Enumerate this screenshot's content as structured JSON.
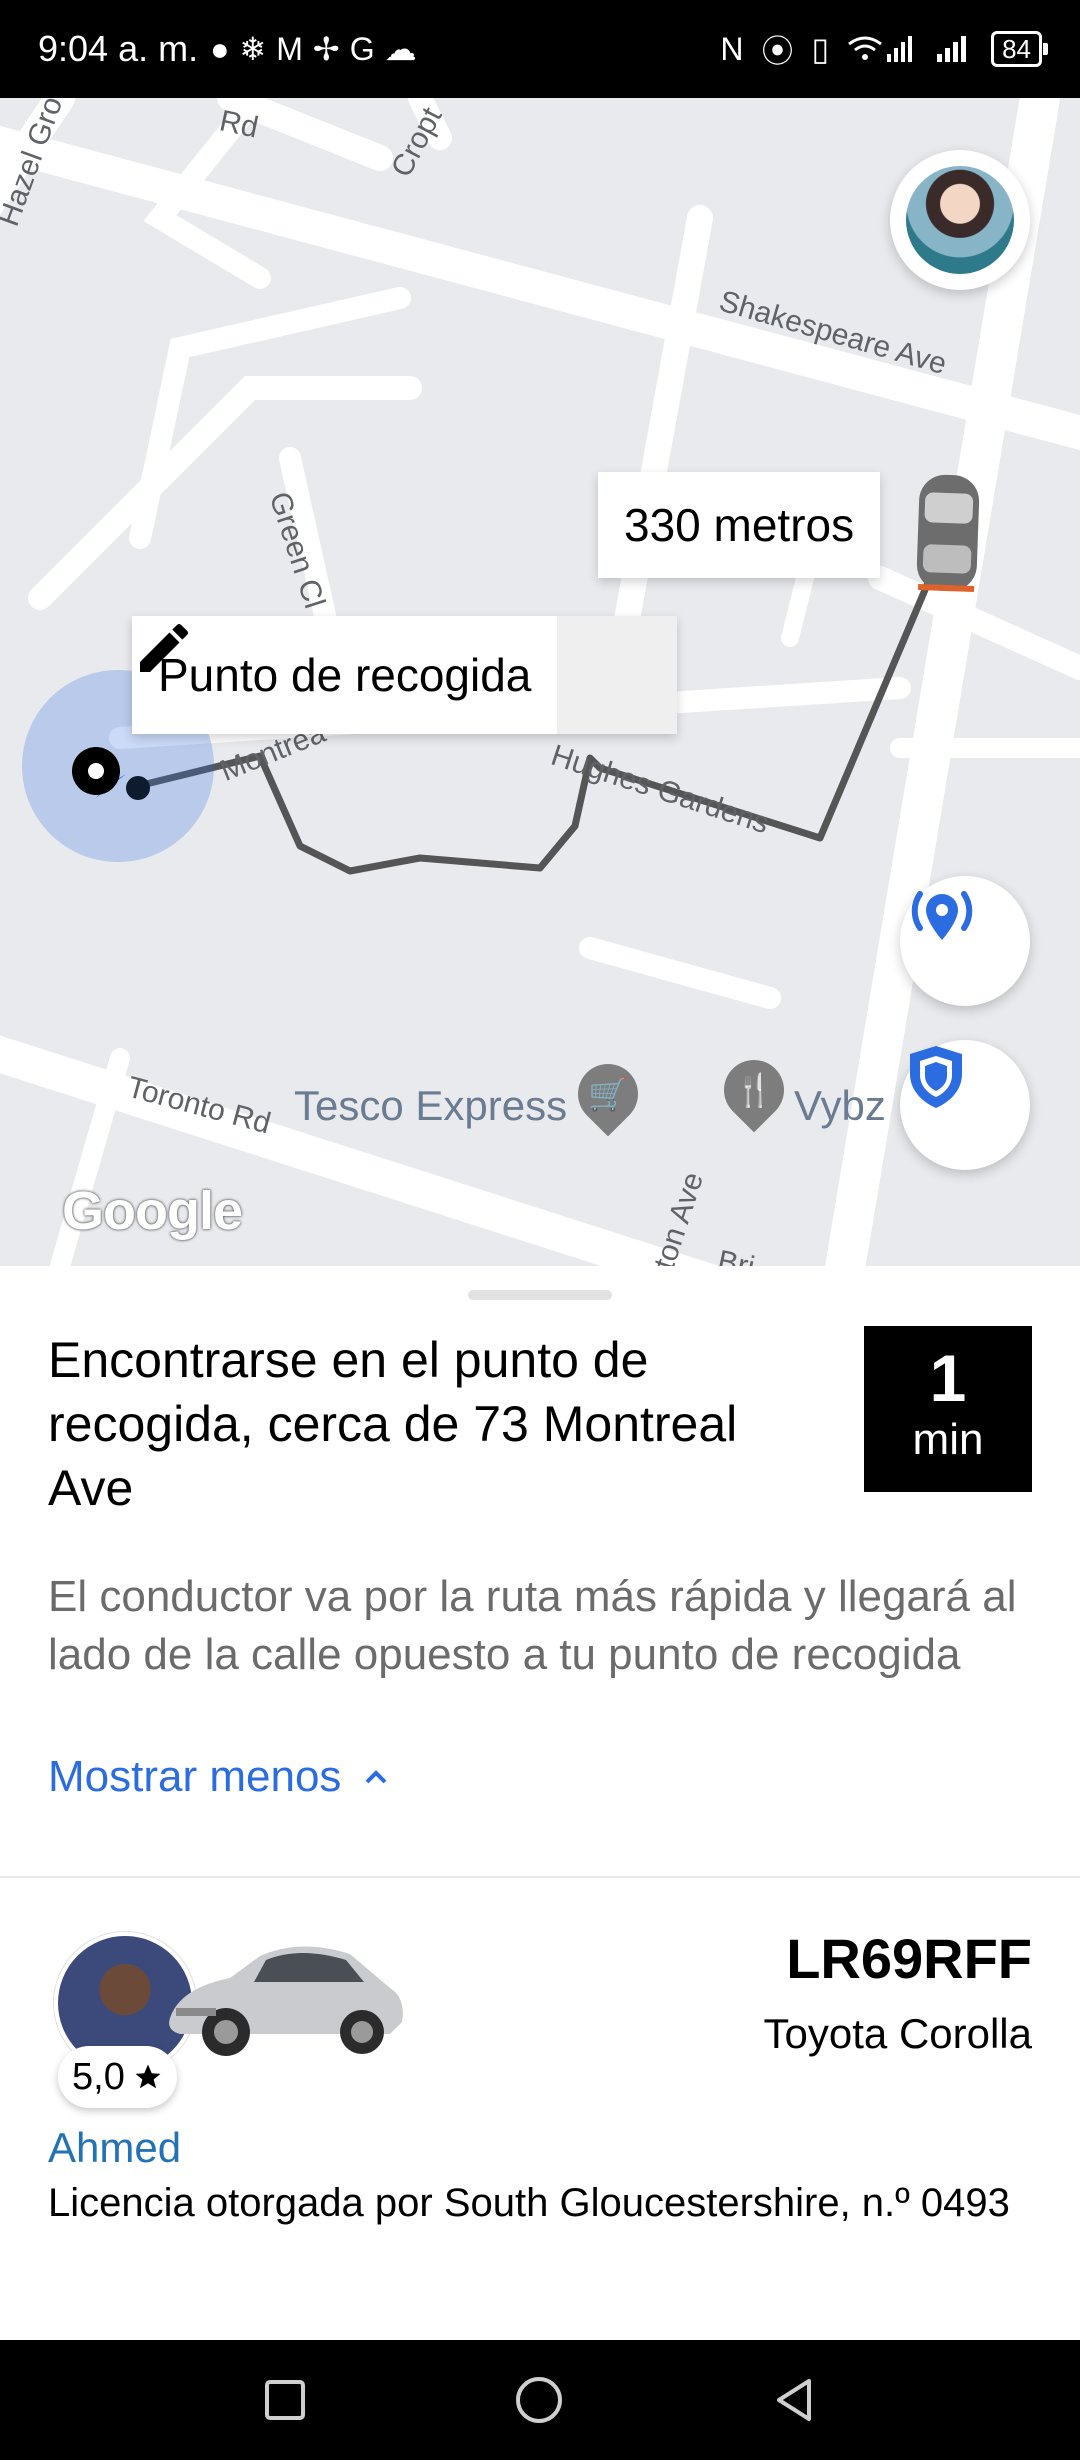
{
  "status_bar": {
    "time": "9:04 a. m.",
    "left_icons": [
      "●",
      "❄",
      "M",
      "✢",
      "G",
      "☁"
    ],
    "right_icons": [
      "N",
      "⦿",
      "▯"
    ],
    "battery": "84"
  },
  "map": {
    "streets": {
      "hazel_grove": "Hazel Grove",
      "top_rd": "Rd",
      "cropt": "Cropt",
      "shakespeare": "Shakespeare Ave",
      "green_cl": "Green Cl",
      "montreal": "Montrea",
      "hughes": "Hughes Gardens",
      "toronto": "Toronto Rd",
      "hamilton": "ilton Ave",
      "bri": "Bri"
    },
    "poi": {
      "tesco": "Tesco Express",
      "vybz": "Vybz"
    },
    "distance_label": "330 metros",
    "pickup_label": "Punto de recogida",
    "google_logo": "Google",
    "accent_color": "#2b6de0"
  },
  "sheet": {
    "heading": "Encontrarse en el punto de recogida, cerca de 73 Montreal Ave",
    "eta_number": "1",
    "eta_unit": "min",
    "description": "El conductor va por la ruta más rápida y llegará al lado de la calle opuesto a tu punto de recogida",
    "show_less": "Mostrar menos",
    "rating": "5,0",
    "plate": "LR69RFF",
    "car_model": "Toyota Corolla",
    "driver_name": "Ahmed",
    "license": "Licencia otorgada por South Gloucestershire, n.º 0493"
  }
}
